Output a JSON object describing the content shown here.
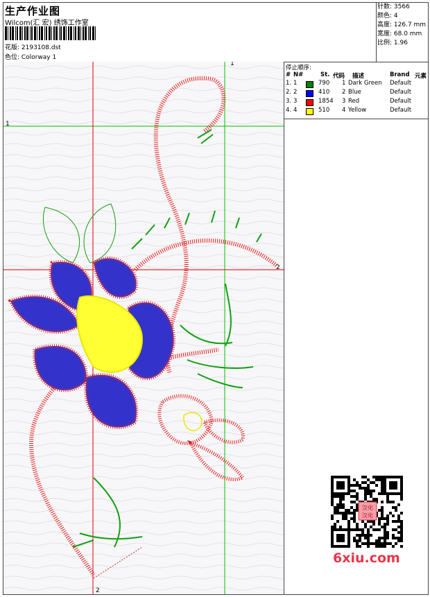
{
  "header": {
    "title": "生产作业图",
    "company": "Wilcom(汇 宏) 绣饰工作室",
    "design_label": "花版:",
    "design_value": "2193108.dst",
    "color_label": "色位:",
    "color_value": "Colorway 1"
  },
  "stats": {
    "stitches": "针数: 3566",
    "colors": "颜色: 4",
    "height": "高度: 126.7 mm",
    "width": "宽度: 68.0 mm",
    "scale": "比例: 1.96"
  },
  "stop_sequence": {
    "title": "停止顺序:",
    "headers": [
      "#",
      "N#",
      "St.",
      "代码",
      "描述",
      "Brand",
      "元素"
    ],
    "rows": [
      {
        "num": "1.",
        "n": "1",
        "color": "#008000",
        "stitches": "790",
        "code": "1",
        "desc": "Dark Green",
        "brand": "Default"
      },
      {
        "num": "2.",
        "n": "2",
        "color": "#0000ff",
        "stitches": "410",
        "code": "2",
        "desc": "Blue",
        "brand": "Default"
      },
      {
        "num": "3.",
        "n": "3",
        "color": "#ff0000",
        "stitches": "1854",
        "code": "3",
        "desc": "Red",
        "brand": "Default"
      },
      {
        "num": "4.",
        "n": "4",
        "color": "#ffff00",
        "stitches": "510",
        "code": "4",
        "desc": "Yellow",
        "brand": "Default"
      }
    ]
  },
  "guides": {
    "top": "1",
    "left": "1",
    "bottom": "2",
    "right": "2"
  },
  "watermark": "6xiu.com",
  "qr_center": "汉化\n汉化"
}
